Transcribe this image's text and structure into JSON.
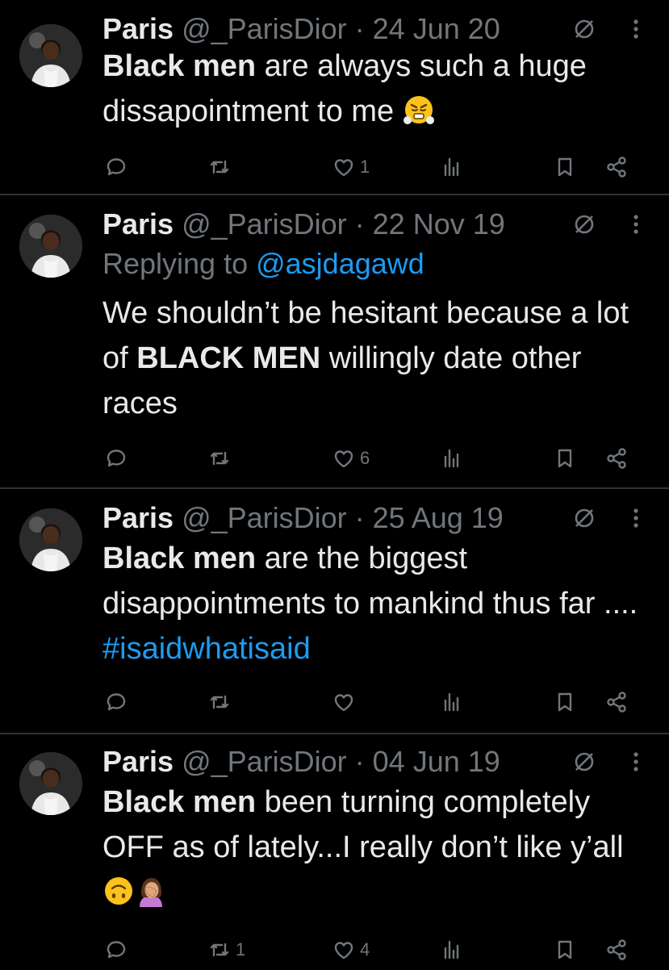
{
  "tweets": [
    {
      "name": "Paris",
      "meta": "@_ParisDior · 24 Jun 20",
      "reply_prefix": "",
      "reply_handle": "",
      "segments": [
        {
          "text": "Black men",
          "bold": true
        },
        {
          "text": " are always such a huge dissapointment to me "
        }
      ],
      "emojis": [
        "face-with-steam-from-nose"
      ],
      "reply_count": "",
      "retweet_count": "",
      "like_count": "1",
      "view_count": ""
    },
    {
      "name": "Paris",
      "meta": "@_ParisDior · 22 Nov 19",
      "reply_prefix": "Replying to ",
      "reply_handle": "@asjdagawd",
      "segments": [
        {
          "text": "We shouldn’t be hesitant because a lot of "
        },
        {
          "text": "BLACK MEN",
          "bold": true
        },
        {
          "text": " willingly date other races"
        }
      ],
      "emojis": [],
      "reply_count": "",
      "retweet_count": "",
      "like_count": "6",
      "view_count": ""
    },
    {
      "name": "Paris",
      "meta": "@_ParisDior · 25 Aug 19",
      "reply_prefix": "",
      "reply_handle": "",
      "segments": [
        {
          "text": "Black men",
          "bold": true
        },
        {
          "text": " are the biggest disappointments to mankind thus far .... "
        },
        {
          "text": "#isaidwhatisaid",
          "tag": true
        }
      ],
      "emojis": [],
      "reply_count": "",
      "retweet_count": "",
      "like_count": "",
      "view_count": ""
    },
    {
      "name": "Paris",
      "meta": "@_ParisDior · 04 Jun 19",
      "reply_prefix": "",
      "reply_handle": "",
      "segments": [
        {
          "text": "Black men",
          "bold": true
        },
        {
          "text": " been turning completely OFF as of lately...I really don’t like y’all "
        }
      ],
      "emojis": [
        "upside-down-face",
        "woman-facepalming"
      ],
      "reply_count": "",
      "retweet_count": "1",
      "like_count": "4",
      "view_count": ""
    }
  ],
  "colors": {
    "background": "#000000",
    "text": "#e7e9ea",
    "muted": "#71767b",
    "link": "#1d9bf0",
    "divider": "#2f3336"
  },
  "icons": {
    "reply": "speech-bubble-icon",
    "retweet": "retweet-icon",
    "like": "heart-icon",
    "views": "bar-chart-icon",
    "bookmark": "bookmark-icon",
    "share": "share-icon",
    "not_following": "slashed-circle-icon",
    "more": "vertical-dots-icon"
  }
}
